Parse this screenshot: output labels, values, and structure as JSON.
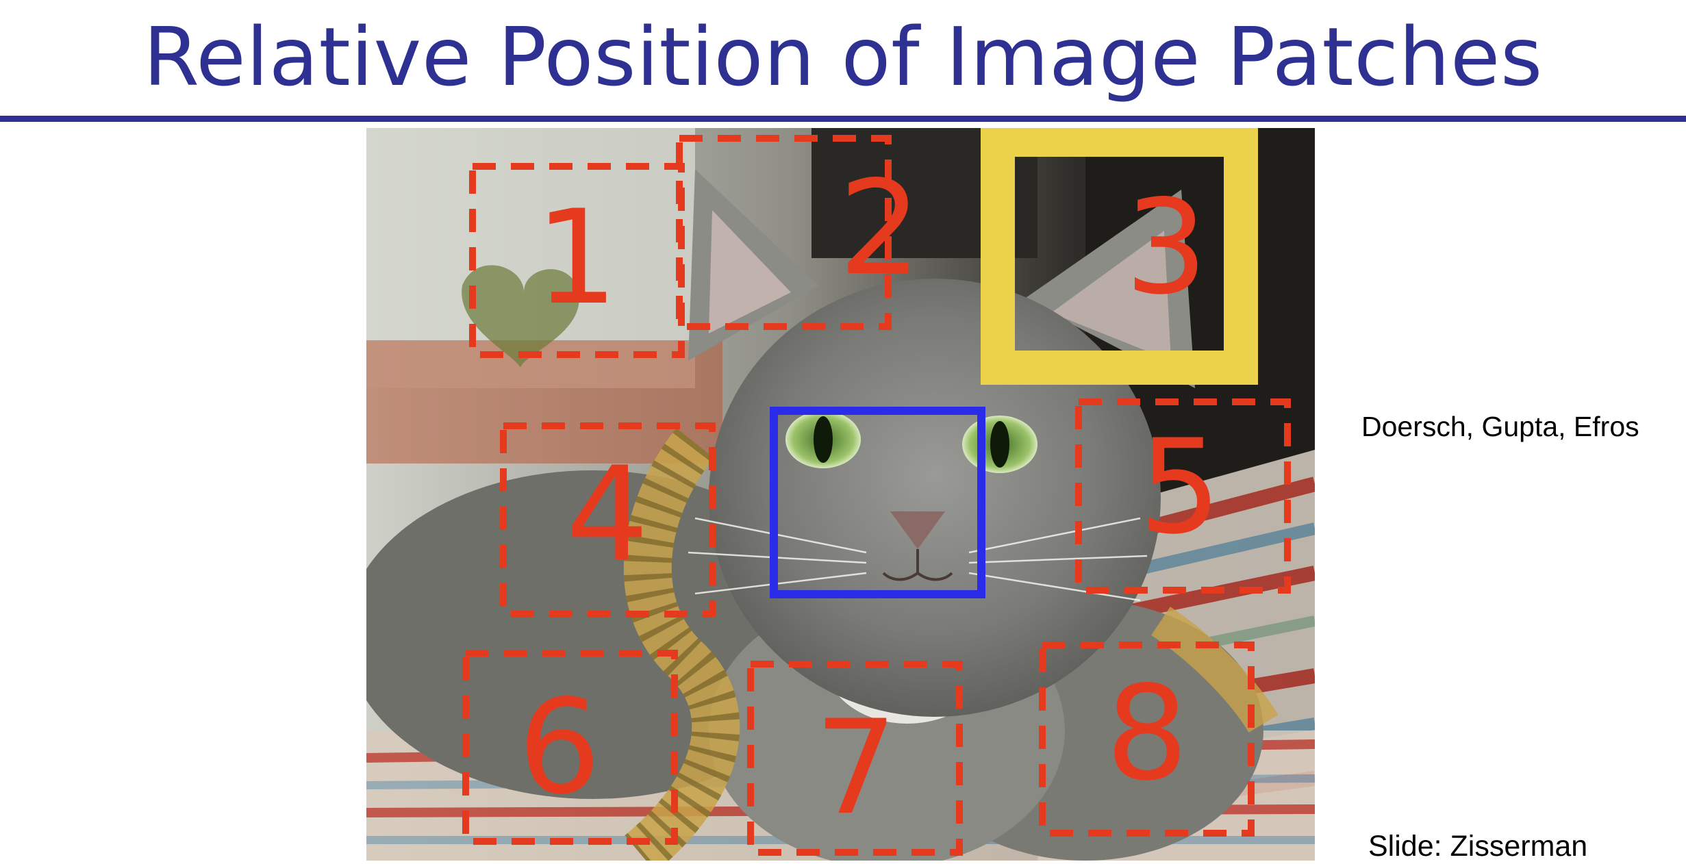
{
  "slide": {
    "title": "Relative Position of Image Patches",
    "citation": "Doersch, Gupta, Efros",
    "credit": "Slide: Zisserman"
  },
  "figure": {
    "patch_labels": [
      "1",
      "2",
      "3",
      "4",
      "5",
      "6",
      "7",
      "8"
    ],
    "colors": {
      "title": "#2e3192",
      "dashed_patch": "#e63a1f",
      "center_patch": "#2b2bea",
      "highlighted_patch": "#ecd24a"
    }
  }
}
